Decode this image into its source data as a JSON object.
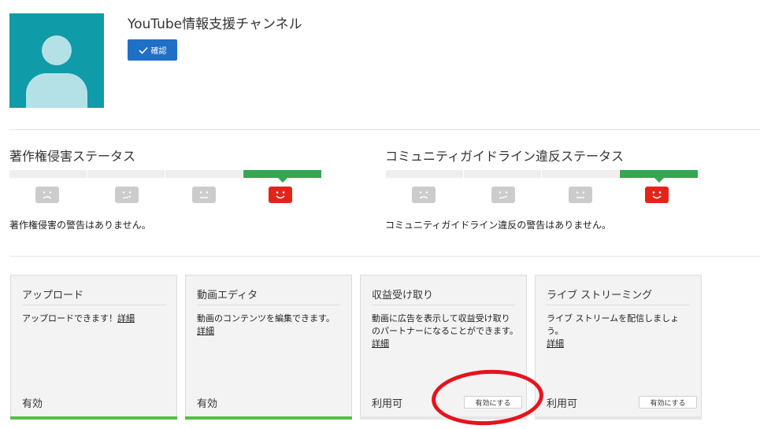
{
  "channel": {
    "title": "YouTube情報支援チャンネル",
    "verify_label": "確認"
  },
  "copyright": {
    "title": "著作権侵害ステータス",
    "message": "著作権侵害の警告はありません。"
  },
  "community": {
    "title": "コミュニティガイドライン違反ステータス",
    "message": "コミュニティガイドライン違反の警告はありません。"
  },
  "cards": [
    {
      "title": "アップロード",
      "description": "アップロードできます！",
      "link": "詳細",
      "status": "有効",
      "button": ""
    },
    {
      "title": "動画エディタ",
      "description": "動画のコンテンツを編集できます。",
      "link": "詳細",
      "status": "有効",
      "button": ""
    },
    {
      "title": "収益受け取り",
      "description": "動画に広告を表示して収益受け取りのパートナーになることができます。",
      "link": "詳細",
      "status": "利用可",
      "button": "有効にする"
    },
    {
      "title": "ライブ ストリーミング",
      "description": "ライブ ストリームを配信しましょう。",
      "link": "詳細",
      "status": "利用可",
      "button": "有効にする"
    }
  ],
  "colors": {
    "avatar_bg": "#0f9ba8",
    "verify_button": "#1f6fc6",
    "status_active": "#33a852",
    "face_active": "#e3241b",
    "enabled_strip": "#53c046",
    "annotation_circle": "#e4141c"
  }
}
